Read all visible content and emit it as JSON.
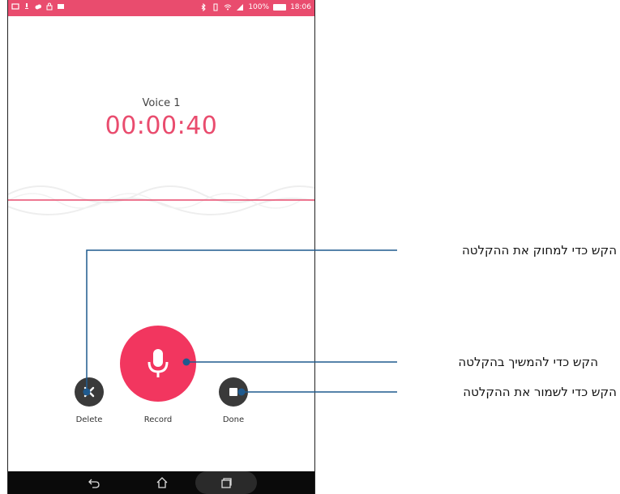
{
  "status_bar": {
    "battery_text": "100%",
    "time": "18:06",
    "color": "#e94c6e"
  },
  "recording": {
    "title": "Voice 1",
    "elapsed": "00:00:40",
    "accent_color": "#e94c6e"
  },
  "controls": {
    "delete_label": "Delete",
    "record_label": "Record",
    "done_label": "Done"
  },
  "nav_bar": {
    "icons": [
      "back-icon",
      "home-icon",
      "recent-apps-icon"
    ]
  },
  "callouts": {
    "delete": "הקש כדי למחוק את ההקלטה",
    "record": "הקש כדי להמשיך בהקלטה",
    "done": "הקש כדי לשמור את ההקלטה",
    "line_color": "#1f5a8e"
  }
}
